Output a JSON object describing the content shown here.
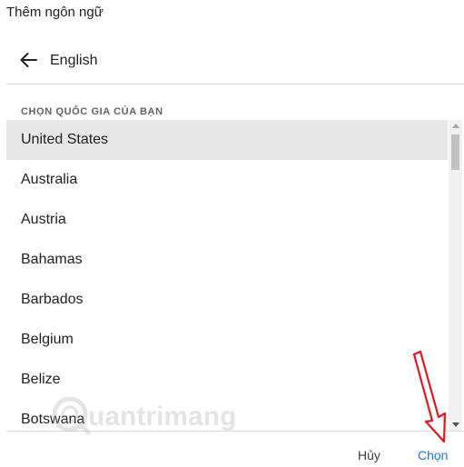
{
  "dialog": {
    "title": "Thêm ngôn ngữ",
    "back_icon": "arrow-back-icon",
    "language": "English",
    "section_label": "CHỌN QUỐC GIA CỦA BẠN",
    "countries": [
      "United States",
      "Australia",
      "Austria",
      "Bahamas",
      "Barbados",
      "Belgium",
      "Belize",
      "Botswana"
    ],
    "selected_country": "United States",
    "buttons": {
      "cancel": "Hủy",
      "choose": "Chọn"
    }
  },
  "watermark": {
    "text": "uantrimang"
  },
  "colors": {
    "accent": "#1a73e8",
    "selected_row": "#e8e8e8",
    "annotation": "#e8141b"
  }
}
